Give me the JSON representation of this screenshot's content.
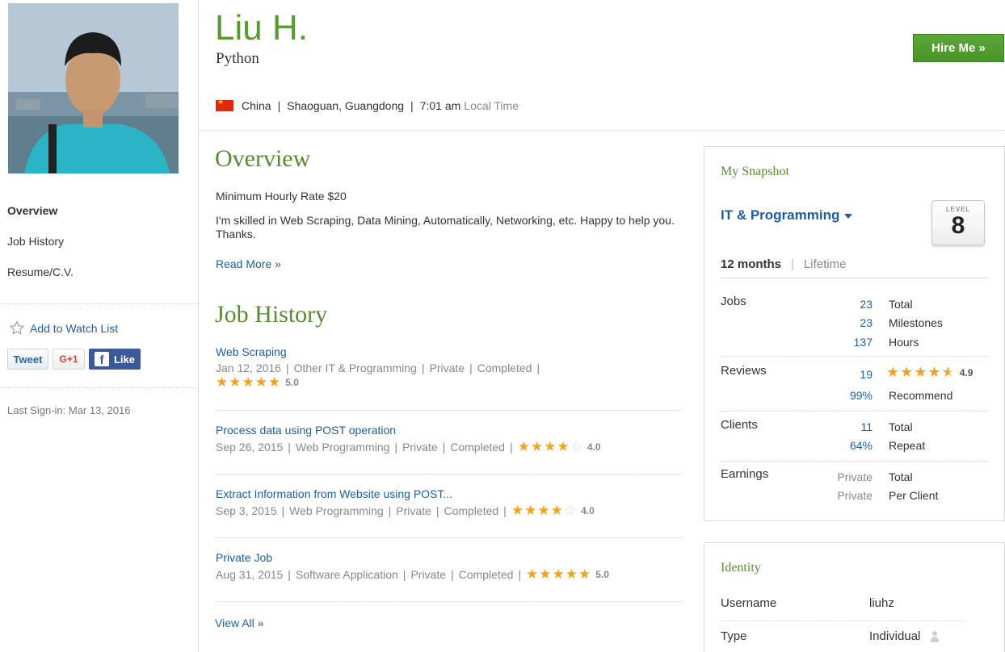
{
  "profile": {
    "name": "Liu H.",
    "title": "Python",
    "country": "China",
    "city": "Shaoguan, Guangdong",
    "local_time": "7:01 am",
    "local_time_label": "Local Time"
  },
  "header": {
    "hire_label": "Hire Me »"
  },
  "sidebar": {
    "nav": [
      "Overview",
      "Job History",
      "Resume/C.V."
    ],
    "watch_label": "Add to Watch List",
    "tweet_label": "Tweet",
    "gplus_label": "G+1",
    "fb_label": "Like",
    "last_signin": "Last Sign-in: Mar 13, 2016"
  },
  "overview": {
    "heading": "Overview",
    "min_rate": "Minimum Hourly Rate $20",
    "text": "I'm skilled in Web Scraping, Data Mining, Automatically, Networking, etc. Happy to help you. Thanks.",
    "read_more": "Read More »"
  },
  "job_history": {
    "heading": "Job History",
    "jobs": [
      {
        "title": "Web Scraping",
        "date": "Jan 12, 2016",
        "category": "Other IT & Programming",
        "visibility": "Private",
        "status": "Completed",
        "rating": 5.0,
        "rating_text": "5.0"
      },
      {
        "title": "Process data using POST operation",
        "date": "Sep 26, 2015",
        "category": "Web Programming",
        "visibility": "Private",
        "status": "Completed",
        "rating": 4.0,
        "rating_text": "4.0"
      },
      {
        "title": "Extract Information from Website using POST...",
        "date": "Sep 3, 2015",
        "category": "Web Programming",
        "visibility": "Private",
        "status": "Completed",
        "rating": 4.0,
        "rating_text": "4.0"
      },
      {
        "title": "Private Job",
        "date": "Aug 31, 2015",
        "category": "Software Application",
        "visibility": "Private",
        "status": "Completed",
        "rating": 5.0,
        "rating_text": "5.0"
      }
    ],
    "view_all": "View All »"
  },
  "snapshot": {
    "title": "My Snapshot",
    "category": "IT & Programming",
    "level_label": "LEVEL",
    "level": "8",
    "period_active": "12 months",
    "period_other": "Lifetime",
    "jobs_label": "Jobs",
    "jobs_total": "23",
    "jobs_total_label": "Total",
    "milestones": "23",
    "milestones_label": "Milestones",
    "hours": "137",
    "hours_label": "Hours",
    "reviews_label": "Reviews",
    "reviews_count": "19",
    "reviews_rating": 4.9,
    "reviews_rating_text": "4.9",
    "recommend": "99%",
    "recommend_label": "Recommend",
    "clients_label": "Clients",
    "clients_total": "11",
    "clients_total_label": "Total",
    "repeat": "64%",
    "repeat_label": "Repeat",
    "earnings_label": "Earnings",
    "earn_total": "Private",
    "earn_total_label": "Total",
    "earn_per_client": "Private",
    "earn_per_client_label": "Per Client"
  },
  "identity": {
    "title": "Identity",
    "username_label": "Username",
    "username": "liuhz",
    "type_label": "Type",
    "type": "Individual"
  },
  "colors": {
    "brand_green": "#5a9a32",
    "link_blue": "#1d5e9e",
    "star": "#f2a21c"
  }
}
